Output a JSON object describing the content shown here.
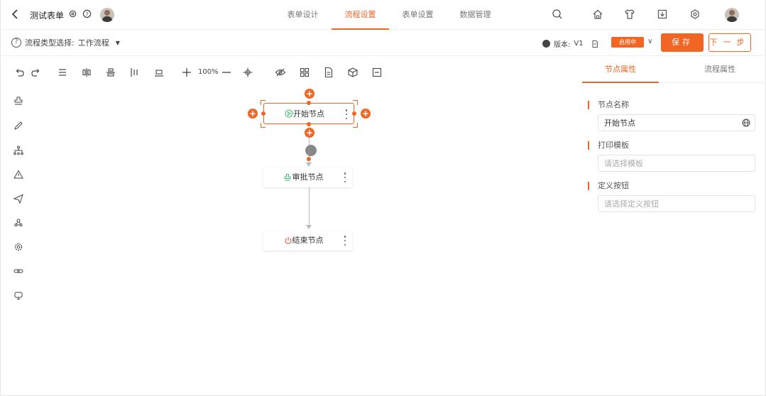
{
  "header": {
    "form_title": "测试表单",
    "tabs": [
      {
        "label": "表单设计",
        "active": false
      },
      {
        "label": "流程设置",
        "active": true
      },
      {
        "label": "表单设置",
        "active": false
      },
      {
        "label": "数据管理",
        "active": false
      }
    ]
  },
  "subbar": {
    "flow_type_label": "流程类型选择:",
    "flow_type_value": "工作流程",
    "version_label": "版本:",
    "version_value": "V1",
    "status_badge": "启用中",
    "save_label": "保存",
    "next_label": "下一步"
  },
  "toolbar": {
    "zoom": "100%"
  },
  "canvas": {
    "start_node": "开始节点",
    "approve_node": "审批节点",
    "end_node": "结束节点"
  },
  "right_panel": {
    "tabs": [
      {
        "label": "节点属性",
        "active": true
      },
      {
        "label": "流程属性",
        "active": false
      }
    ],
    "node_name_label": "节点名称",
    "node_name_value": "开始节点",
    "print_template_label": "打印模板",
    "print_template_placeholder": "请选择模板",
    "custom_button_label": "定义按钮",
    "custom_button_placeholder": "请选择定义按钮"
  },
  "colors": {
    "accent": "#f26522",
    "start_icon": "#4cba7a",
    "approve_icon": "#4cba7a",
    "end_icon": "#e24b3b"
  }
}
